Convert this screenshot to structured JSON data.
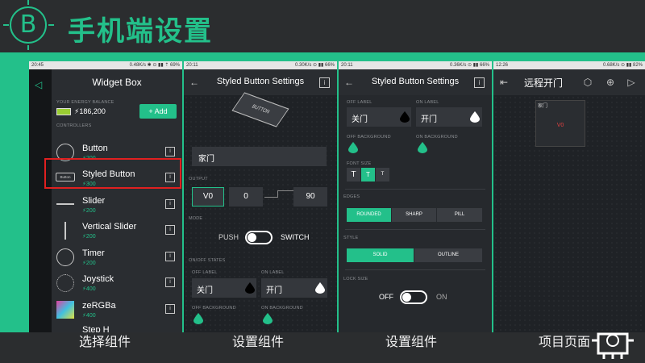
{
  "header": {
    "logo_letter": "B",
    "title": "手机端设置"
  },
  "captions": [
    "选择组件",
    "设置组件",
    "设置组件",
    "项目页面"
  ],
  "phone1": {
    "status_time": "20:45",
    "status_right": "0.48K/s ✱ ⊙ ▮▮ ⇡ 69%",
    "title": "Widget Box",
    "energy_label": "YOUR ENERGY BALANCE",
    "balance": "186,200",
    "add_label": "+ Add",
    "controllers_label": "CONTROLLERS",
    "widgets": [
      {
        "name": "Button",
        "price": "200"
      },
      {
        "name": "Styled Button",
        "price": "300"
      },
      {
        "name": "Slider",
        "price": "200"
      },
      {
        "name": "Vertical Slider",
        "price": "200"
      },
      {
        "name": "Timer",
        "price": "200"
      },
      {
        "name": "Joystick",
        "price": "400"
      },
      {
        "name": "zeRGBa",
        "price": "400"
      },
      {
        "name": "Step H",
        "price": ""
      }
    ],
    "button_icon_text": "Button"
  },
  "phone2": {
    "status_time": "20:11",
    "status_right": "0.30K/s ⊙ ▮▮ 66%",
    "title": "Styled Button Settings",
    "preview_text": "BUTTON",
    "name_value": "家门",
    "output_label": "OUTPUT",
    "pin": "V0",
    "out_low": "0",
    "out_high": "90",
    "mode_label": "MODE",
    "push_label": "PUSH",
    "switch_label": "SWITCH",
    "states_label": "ON/OFF STATES",
    "off_label": "OFF LABEL",
    "on_label": "ON LABEL",
    "off_value": "关门",
    "on_value": "开门",
    "off_bg_label": "OFF BACKGROUND",
    "on_bg_label": "ON BACKGROUND"
  },
  "phone3": {
    "status_time": "20:11",
    "status_right": "0.36K/s ⊙ ▮▮ 66%",
    "title": "Styled Button Settings",
    "off_label": "OFF LABEL",
    "on_label": "ON LABEL",
    "off_value": "关门",
    "on_value": "开门",
    "off_bg_label": "OFF BACKGROUND",
    "on_bg_label": "ON BACKGROUND",
    "font_size_label": "FONT SIZE",
    "font_sizes": [
      "T",
      "T",
      "T"
    ],
    "edges_label": "EDGES",
    "edges": [
      "ROUNDED",
      "SHARP",
      "PILL"
    ],
    "style_label": "STYLE",
    "styles": [
      "SOLID",
      "OUTLINE"
    ],
    "lock_label": "LOCK SIZE",
    "off_text": "OFF",
    "on_text": "ON"
  },
  "phone4": {
    "status_time": "12:26",
    "status_right": "0.68K/s ⊙ ▮▮ 82%",
    "title": "远程开门",
    "widget_name": "家门",
    "widget_pin": "V0"
  },
  "colors": {
    "accent": "#23c08a",
    "dark": "#2b2d2f",
    "highlight": "#e02020"
  }
}
